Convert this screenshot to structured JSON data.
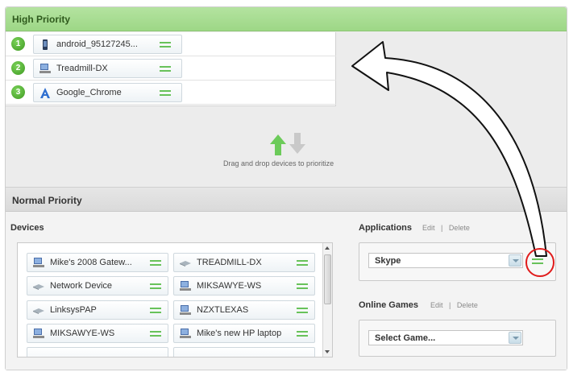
{
  "high_priority": {
    "title": "High Priority",
    "devices": [
      {
        "rank": "1",
        "name": "android_95127245...",
        "icon": "phone-icon"
      },
      {
        "rank": "2",
        "name": "Treadmill-DX",
        "icon": "desktop-icon"
      },
      {
        "rank": "3",
        "name": "Google_Chrome",
        "icon": "chrome-app-icon"
      }
    ]
  },
  "hint": "Drag and drop devices to prioritize",
  "normal_priority": {
    "title": "Normal Priority",
    "devices_label": "Devices",
    "devices": [
      {
        "name": "Mike's 2008 Gatew...",
        "icon": "desktop-icon"
      },
      {
        "name": "TREADMILL-DX",
        "icon": "network-device-icon"
      },
      {
        "name": "Network Device",
        "icon": "network-device-icon"
      },
      {
        "name": "MIKSAWYE-WS",
        "icon": "desktop-icon"
      },
      {
        "name": "LinksysPAP",
        "icon": "network-device-icon"
      },
      {
        "name": "NZXTLEXAS",
        "icon": "desktop-icon"
      },
      {
        "name": "MIKSAWYE-WS",
        "icon": "desktop-icon"
      },
      {
        "name": "Mike's new HP laptop",
        "icon": "desktop-icon"
      }
    ],
    "applications": {
      "label": "Applications",
      "edit": "Edit",
      "separator": "|",
      "delete": "Delete",
      "selected": "Skype"
    },
    "online_games": {
      "label": "Online Games",
      "edit": "Edit",
      "separator": "|",
      "delete": "Delete",
      "selected": "Select Game..."
    }
  },
  "colors": {
    "accent_green": "#68c25a",
    "header_green": "#a8dd92",
    "annotation_red": "#e01b1b"
  }
}
